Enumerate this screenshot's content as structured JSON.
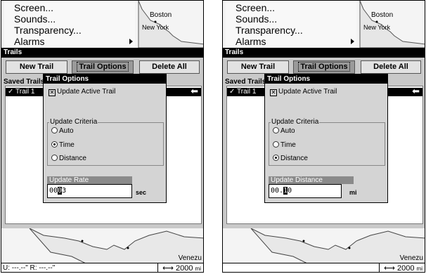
{
  "menu": {
    "items": [
      "Screen...",
      "Sounds...",
      "Transparency...",
      "Alarms"
    ]
  },
  "map": {
    "labels": [
      "Boston",
      "New York"
    ],
    "bottom_place": "Venezu"
  },
  "window": {
    "title": "Trails",
    "buttons": {
      "new": "New Trail",
      "options": "Trail Options",
      "delete_all": "Delete All"
    },
    "saved_label": "Saved Trails",
    "trail_item": "Trail 1",
    "trail_item_check": "✓"
  },
  "dialog": {
    "title": "Trail Options",
    "update_active": "Update Active Trail",
    "criteria_label": "Update Criteria",
    "options": [
      "Auto",
      "Time",
      "Distance"
    ]
  },
  "left": {
    "selected_option": "Time",
    "field_label": "Update Rate",
    "field_prefix": "00",
    "field_cursor": "0",
    "field_suffix": "3",
    "field_unit": "sec",
    "status_left": "U: ---.--\"   R: ---.--\"",
    "scale": "2000",
    "scale_unit": "mi"
  },
  "right": {
    "selected_option": "Distance",
    "field_label": "Update Distance",
    "field_prefix": "00.",
    "field_cursor": "1",
    "field_suffix": "0",
    "field_unit": "mi",
    "scale": "2000",
    "scale_unit": "mi"
  }
}
